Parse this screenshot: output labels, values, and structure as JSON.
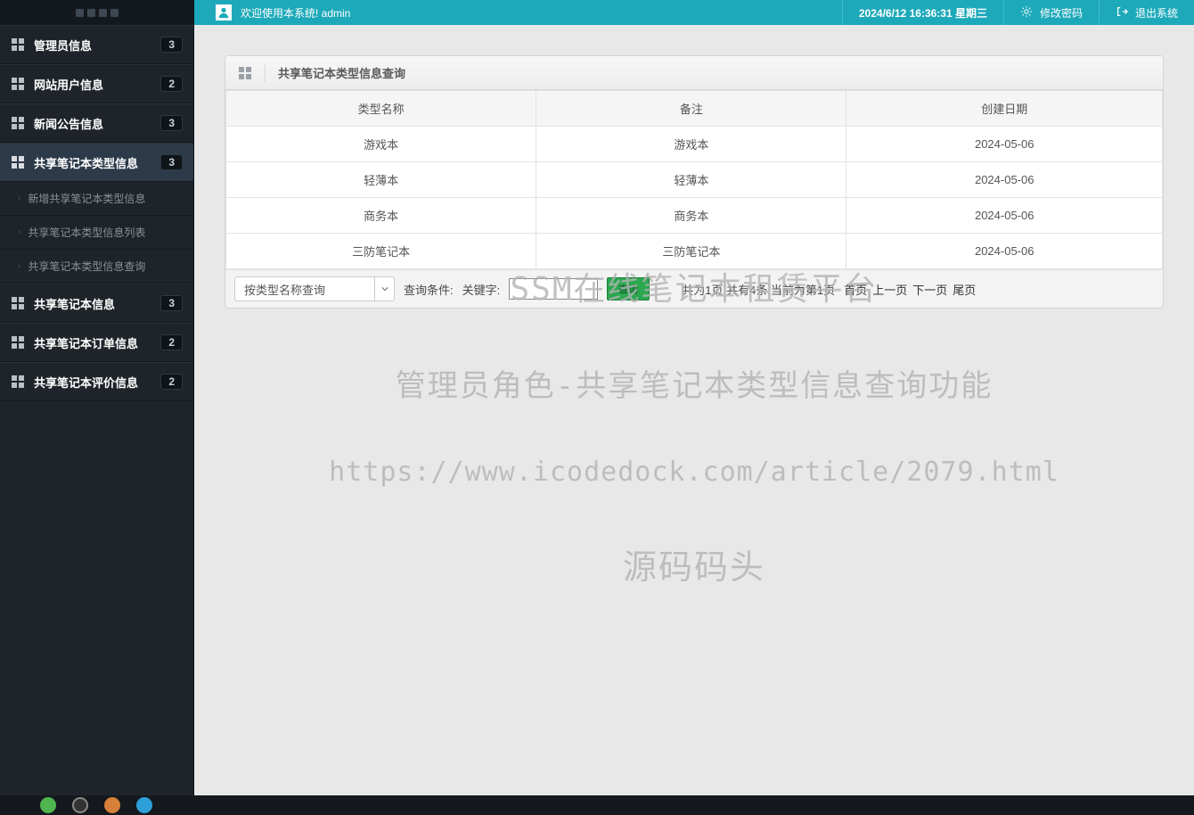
{
  "header": {
    "welcome": "欢迎使用本系统! admin",
    "datetime": "2024/6/12 16:36:31 星期三",
    "change_password": "修改密码",
    "logout": "退出系统"
  },
  "sidebar": {
    "items": [
      {
        "label": "管理员信息",
        "badge": "3"
      },
      {
        "label": "网站用户信息",
        "badge": "2"
      },
      {
        "label": "新闻公告信息",
        "badge": "3"
      },
      {
        "label": "共享笔记本类型信息",
        "badge": "3"
      },
      {
        "label": "共享笔记本信息",
        "badge": "3"
      },
      {
        "label": "共享笔记本订单信息",
        "badge": "2"
      },
      {
        "label": "共享笔记本评价信息",
        "badge": "2"
      }
    ],
    "sub_items": [
      "新增共享笔记本类型信息",
      "共享笔记本类型信息列表",
      "共享笔记本类型信息查询"
    ]
  },
  "panel": {
    "title": "共享笔记本类型信息查询"
  },
  "table": {
    "headers": [
      "类型名称",
      "备注",
      "创建日期"
    ],
    "rows": [
      [
        "游戏本",
        "游戏本",
        "2024-05-06"
      ],
      [
        "轻薄本",
        "轻薄本",
        "2024-05-06"
      ],
      [
        "商务本",
        "商务本",
        "2024-05-06"
      ],
      [
        "三防笔记本",
        "三防笔记本",
        "2024-05-06"
      ]
    ]
  },
  "query": {
    "dropdown": "按类型名称查询",
    "cond_label": "查询条件:",
    "keyword_label": "关键字:",
    "submit": "查询",
    "pager_summary": "共为1页  共有4条  当前为第1页",
    "first": "首页",
    "prev": "上一页",
    "next": "下一页",
    "last": "尾页"
  },
  "watermark": {
    "line1": "SSM在线笔记本租赁平台",
    "line2": "管理员角色-共享笔记本类型信息查询功能",
    "line3": "https://www.icodedock.com/article/2079.html",
    "line4": "源码码头"
  }
}
